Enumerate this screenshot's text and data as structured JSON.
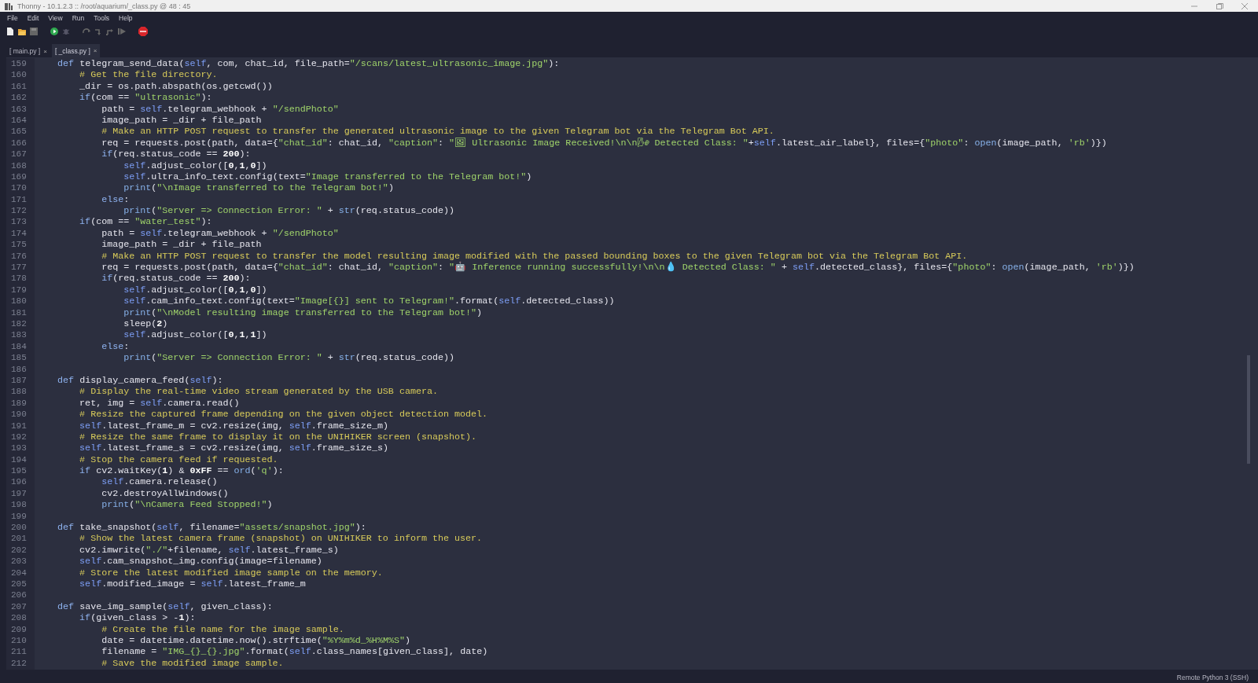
{
  "window": {
    "title": "Thonny  -  10.1.2.3 :: /root/aquarium/_class.py  @  48 : 45"
  },
  "menu": [
    "File",
    "Edit",
    "View",
    "Run",
    "Tools",
    "Help"
  ],
  "tabs": [
    {
      "label": "[ main.py ]",
      "close": "×",
      "selected": false
    },
    {
      "label": "[ _class.py ]",
      "close": "×",
      "selected": true
    }
  ],
  "editor": {
    "lines": [
      {
        "number": "159",
        "code": "    def telegram_send_data(self, com, chat_id, file_path=\"/scans/latest_ultrasonic_image.jpg\"):"
      },
      {
        "number": "160",
        "code": "        # Get the file directory."
      },
      {
        "number": "161",
        "code": "        _dir = os.path.abspath(os.getcwd())"
      },
      {
        "number": "162",
        "code": "        if(com == \"ultrasonic\"):"
      },
      {
        "number": "163",
        "code": "            path = self.telegram_webhook + \"/sendPhoto\""
      },
      {
        "number": "164",
        "code": "            image_path = _dir + file_path"
      },
      {
        "number": "165",
        "code": "            # Make an HTTP POST request to transfer the generated ultrasonic image to the given Telegram bot via the Telegram Bot API."
      },
      {
        "number": "166",
        "code": "            req = requests.post(path, data={\"chat_id\": chat_id, \"caption\": \"🖼 Ultrasonic Image Received!\\n\\n🌬 Detected Class: \"+self.latest_air_label}, files={\"photo\": open(image_path, 'rb')})"
      },
      {
        "number": "167",
        "code": "            if(req.status_code == 200):"
      },
      {
        "number": "168",
        "code": "                self.adjust_color([0,1,0])"
      },
      {
        "number": "169",
        "code": "                self.ultra_info_text.config(text=\"Image transferred to the Telegram bot!\")"
      },
      {
        "number": "170",
        "code": "                print(\"\\nImage transferred to the Telegram bot!\")"
      },
      {
        "number": "171",
        "code": "            else:"
      },
      {
        "number": "172",
        "code": "                print(\"Server => Connection Error: \" + str(req.status_code))"
      },
      {
        "number": "173",
        "code": "        if(com == \"water_test\"):"
      },
      {
        "number": "174",
        "code": "            path = self.telegram_webhook + \"/sendPhoto\""
      },
      {
        "number": "175",
        "code": "            image_path = _dir + file_path"
      },
      {
        "number": "176",
        "code": "            # Make an HTTP POST request to transfer the model resulting image modified with the passed bounding boxes to the given Telegram bot via the Telegram Bot API."
      },
      {
        "number": "177",
        "code": "            req = requests.post(path, data={\"chat_id\": chat_id, \"caption\": \"🤖 Inference running successfully!\\n\\n💧 Detected Class: \" + self.detected_class}, files={\"photo\": open(image_path, 'rb')})"
      },
      {
        "number": "178",
        "code": "            if(req.status_code == 200):"
      },
      {
        "number": "179",
        "code": "                self.adjust_color([0,1,0])"
      },
      {
        "number": "180",
        "code": "                self.cam_info_text.config(text=\"Image[{}] sent to Telegram!\".format(self.detected_class))"
      },
      {
        "number": "181",
        "code": "                print(\"\\nModel resulting image transferred to the Telegram bot!\")"
      },
      {
        "number": "182",
        "code": "                sleep(2)"
      },
      {
        "number": "183",
        "code": "                self.adjust_color([0,1,1])"
      },
      {
        "number": "184",
        "code": "            else:"
      },
      {
        "number": "185",
        "code": "                print(\"Server => Connection Error: \" + str(req.status_code))"
      },
      {
        "number": "186"
      },
      {
        "number": "187",
        "code": "    def display_camera_feed(self):"
      },
      {
        "number": "188",
        "code": "        # Display the real-time video stream generated by the USB camera."
      },
      {
        "number": "189",
        "code": "        ret, img = self.camera.read()"
      },
      {
        "number": "190",
        "code": "        # Resize the captured frame depending on the given object detection model."
      },
      {
        "number": "191",
        "code": "        self.latest_frame_m = cv2.resize(img, self.frame_size_m)"
      },
      {
        "number": "192",
        "code": "        # Resize the same frame to display it on the UNIHIKER screen (snapshot)."
      },
      {
        "number": "193",
        "code": "        self.latest_frame_s = cv2.resize(img, self.frame_size_s)"
      },
      {
        "number": "194",
        "code": "        # Stop the camera feed if requested."
      },
      {
        "number": "195",
        "code": "        if cv2.waitKey(1) & 0xFF == ord('q'):"
      },
      {
        "number": "196",
        "code": "            self.camera.release()"
      },
      {
        "number": "197",
        "code": "            cv2.destroyAllWindows()"
      },
      {
        "number": "198",
        "code": "            print(\"\\nCamera Feed Stopped!\")"
      },
      {
        "number": "199"
      },
      {
        "number": "200",
        "code": "    def take_snapshot(self, filename=\"assets/snapshot.jpg\"):"
      },
      {
        "number": "201",
        "code": "        # Show the latest camera frame (snapshot) on UNIHIKER to inform the user."
      },
      {
        "number": "202",
        "code": "        cv2.imwrite(\"./\"+filename, self.latest_frame_s)"
      },
      {
        "number": "203",
        "code": "        self.cam_snapshot_img.config(image=filename)"
      },
      {
        "number": "204",
        "code": "        # Store the latest modified image sample on the memory."
      },
      {
        "number": "205",
        "code": "        self.modified_image = self.latest_frame_m"
      },
      {
        "number": "206"
      },
      {
        "number": "207",
        "code": "    def save_img_sample(self, given_class):"
      },
      {
        "number": "208",
        "code": "        if(given_class > -1):"
      },
      {
        "number": "209",
        "code": "            # Create the file name for the image sample."
      },
      {
        "number": "210",
        "code": "            date = datetime.datetime.now().strftime(\"%Y%m%d_%H%M%S\")"
      },
      {
        "number": "211",
        "code": "            filename = \"IMG_{}_{}.jpg\".format(self.class_names[given_class], date)"
      },
      {
        "number": "212",
        "code": "            # Save the modified image sample."
      }
    ]
  },
  "status_bar": {
    "text": "Remote Python 3 (SSH)"
  }
}
